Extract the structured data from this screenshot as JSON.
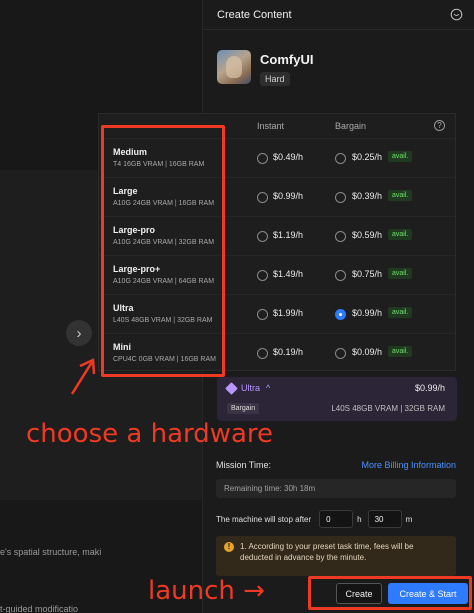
{
  "background": {
    "line1": "e's spatial structure, maki",
    "line2": "t-guided modificatio"
  },
  "drawer": {
    "title": "Create Content",
    "app": {
      "name": "ComfyUI",
      "badge": "Hard"
    },
    "table": {
      "col_instant": "Instant",
      "col_bargain": "Bargain",
      "help": "?",
      "rows": [
        {
          "name": "Medium",
          "spec": "T4 16GB VRAM | 16GB RAM",
          "instant": "$0.49/h",
          "bargain": "$0.25/h",
          "badge": "avail."
        },
        {
          "name": "Large",
          "spec": "A10G 24GB VRAM | 16GB RAM",
          "instant": "$0.99/h",
          "bargain": "$0.39/h",
          "badge": "avail."
        },
        {
          "name": "Large-pro",
          "spec": "A10G 24GB VRAM | 32GB RAM",
          "instant": "$1.19/h",
          "bargain": "$0.59/h",
          "badge": "avail."
        },
        {
          "name": "Large-pro+",
          "spec": "A10G 24GB VRAM | 64GB RAM",
          "instant": "$1.49/h",
          "bargain": "$0.75/h",
          "badge": "avail."
        },
        {
          "name": "Ultra",
          "spec": "L40S 48GB VRAM | 32GB RAM",
          "instant": "$1.99/h",
          "bargain": "$0.99/h",
          "badge": "avail."
        },
        {
          "name": "Mini",
          "spec": "CPU4C 0GB VRAM | 16GB RAM",
          "instant": "$0.19/h",
          "bargain": "$0.09/h",
          "badge": "avail."
        }
      ],
      "selected": {
        "row": "Ultra",
        "column": "Bargain"
      }
    },
    "summary": {
      "plan": "Ultra",
      "chevron": "^",
      "price": "$0.99/h",
      "badge": "Bargain",
      "spec": "L40S 48GB VRAM | 32GB RAM"
    },
    "mission": {
      "label": "Mission Time:",
      "billing_link": "More Billing Information",
      "remaining": "Remaining time: 30h 18m",
      "stop_text": "The machine will stop after",
      "hours": "0",
      "hours_unit": "h",
      "minutes": "30",
      "minutes_unit": "m"
    },
    "notice": {
      "icon": "!",
      "text": "1. According to your preset task time, fees will be deducted in advance by the minute."
    },
    "buttons": {
      "create": "Create",
      "create_start": "Create & Start"
    }
  },
  "annotations": {
    "choose": "choose a hardware",
    "launch": "launch →"
  },
  "colors": {
    "accent": "#2f7bff",
    "annotation": "#ee3a24",
    "avail": "#6fe06b",
    "ultra": "#b896ff"
  },
  "icons": [
    "chat-icon",
    "help-icon",
    "diamond-icon",
    "chevron-up-icon",
    "warning-icon",
    "chevron-right-icon"
  ]
}
